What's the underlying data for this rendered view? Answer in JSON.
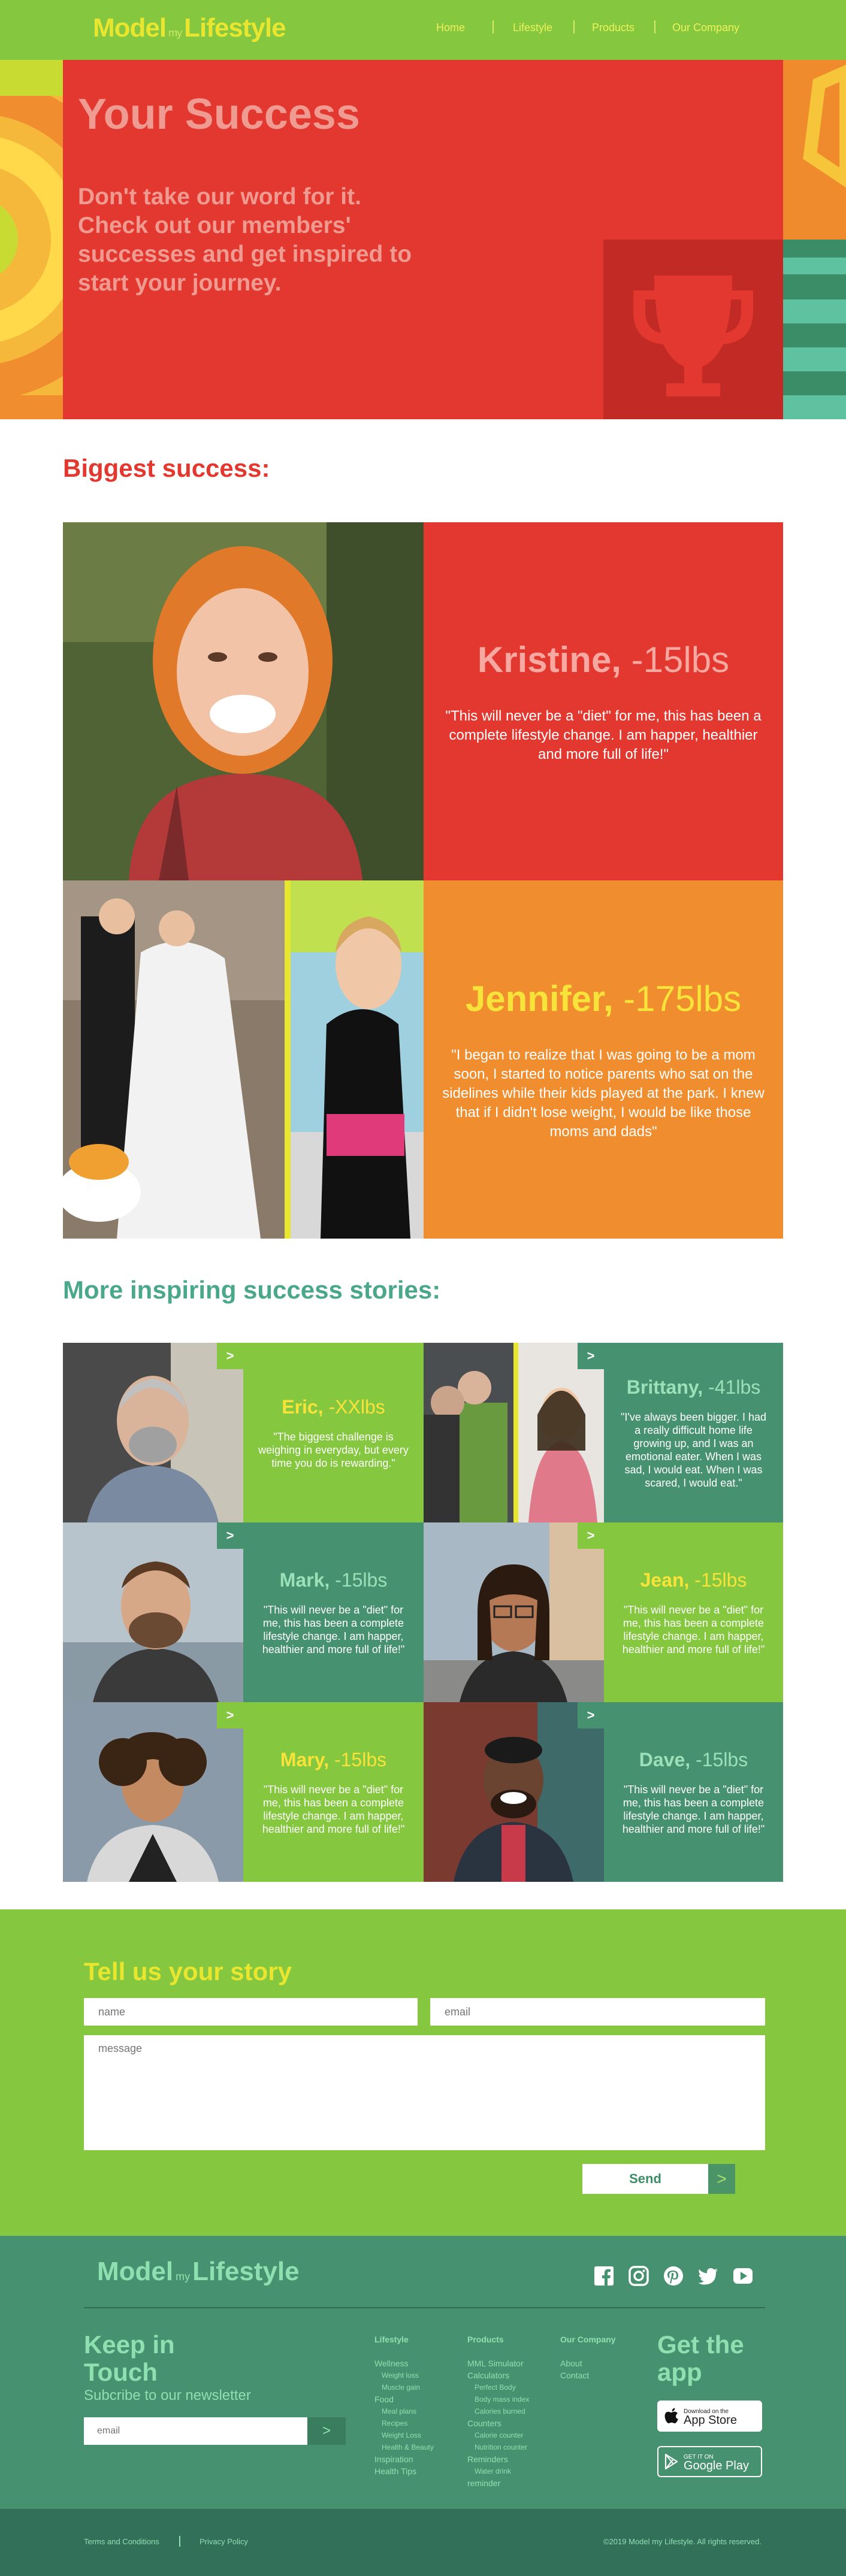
{
  "nav": {
    "logo": {
      "model": "Model",
      "my": "my",
      "lifestyle": "Lifestyle"
    },
    "links": [
      "Home",
      "Lifestyle",
      "Products",
      "Our Company"
    ]
  },
  "hero": {
    "title": "Your Success",
    "subtitle": "Don't take our word for it. Check out our members' successes and get inspired to start your journey.",
    "icon": "trophy-icon"
  },
  "biggest": {
    "heading": "Biggest success:",
    "stories": [
      {
        "name": "Kristine,",
        "loss": " -15lbs",
        "quote": "\"This will never be a \"diet\" for me, this has been a complete lifestyle change. I am happer, healthier and more full of life!\""
      },
      {
        "name": "Jennifer,",
        "loss": " -175lbs",
        "quote": "\"I began to realize that I was going to be a mom soon, I started to notice parents who sat on the sidelines while their kids played at the park. I knew that if I didn't lose weight, I would be like those moms and dads\""
      }
    ]
  },
  "more": {
    "heading": "More inspiring success stories:",
    "stories": [
      {
        "name": "Eric,",
        "loss": " -XXlbs",
        "quote": "\"The biggest challenge is weighing in everyday, but every time you do is rewarding.\""
      },
      {
        "name": "Brittany,",
        "loss": " -41lbs",
        "quote": "\"I've always been bigger. I had a really difficult home life growing up, and I was an emotional eater. When I was sad, I would eat. When I was scared, I would eat.\""
      },
      {
        "name": "Mark,",
        "loss": " -15lbs",
        "quote": "\"This will never be a \"diet\" for me, this has been a complete lifestyle change. I am happer, healthier and more full of life!\""
      },
      {
        "name": "Jean,",
        "loss": " -15lbs",
        "quote": "\"This will never be a \"diet\" for me, this has been a complete lifestyle change. I am happer, healthier and more full of life!\""
      },
      {
        "name": "Mary,",
        "loss": " -15lbs",
        "quote": "\"This will never be a \"diet\" for me, this has been a complete lifestyle change. I am happer, healthier and more full of life!\""
      },
      {
        "name": "Dave,",
        "loss": " -15lbs",
        "quote": "\"This will never be a \"diet\" for me, this has been a complete lifestyle change. I am happer, healthier and more full of life!\""
      }
    ],
    "arrow": ">"
  },
  "form": {
    "heading": "Tell us your story",
    "name_placeholder": "name",
    "email_placeholder": "email",
    "message_placeholder": "message",
    "send_label": "Send",
    "send_arrow": ">"
  },
  "footer": {
    "logo": {
      "model": "Model",
      "my": "my",
      "lifestyle": "Lifestyle"
    },
    "keep_in_touch": "Keep in Touch",
    "newsletter": "Subcribe to our newsletter",
    "email_placeholder": "email",
    "email_arrow": ">",
    "columns": {
      "lifestyle": {
        "title": "Lifestyle",
        "items": [
          "Wellness",
          "Weight loss",
          "Muscle gain",
          "Food",
          "Meal plans",
          "Recipes",
          "Weight Loss",
          "Health & Beauty",
          "Inspiration",
          "Health Tips"
        ]
      },
      "products": {
        "title": "Products",
        "items": [
          "MML Simulator",
          "Calculators",
          "Perfect Body",
          "Body mass index",
          "Calories burned",
          "Counters",
          "Calorie counter",
          "Nutrition counter",
          "Reminders",
          "Water drink",
          "reminder"
        ]
      },
      "company": {
        "title": "Our Company",
        "items": [
          "About",
          "Contact"
        ]
      }
    },
    "get_app": "Get the app",
    "app_store": {
      "small": "Download on the",
      "big": "App Store"
    },
    "google_play": {
      "small": "GET IT ON",
      "big": "Google Play"
    },
    "terms": "Terms and Conditions",
    "privacy": "Privacy Policy",
    "copyright": "©2019 Model my Lifestyle. All rights reserved.",
    "social_icons": [
      "facebook-icon",
      "instagram-icon",
      "pinterest-icon",
      "twitter-icon",
      "youtube-icon"
    ]
  },
  "colors": {
    "green": "#85c73e",
    "red": "#e2382f",
    "orange": "#f08d2e",
    "teal": "#469270",
    "yellow": "#e8e62f"
  }
}
